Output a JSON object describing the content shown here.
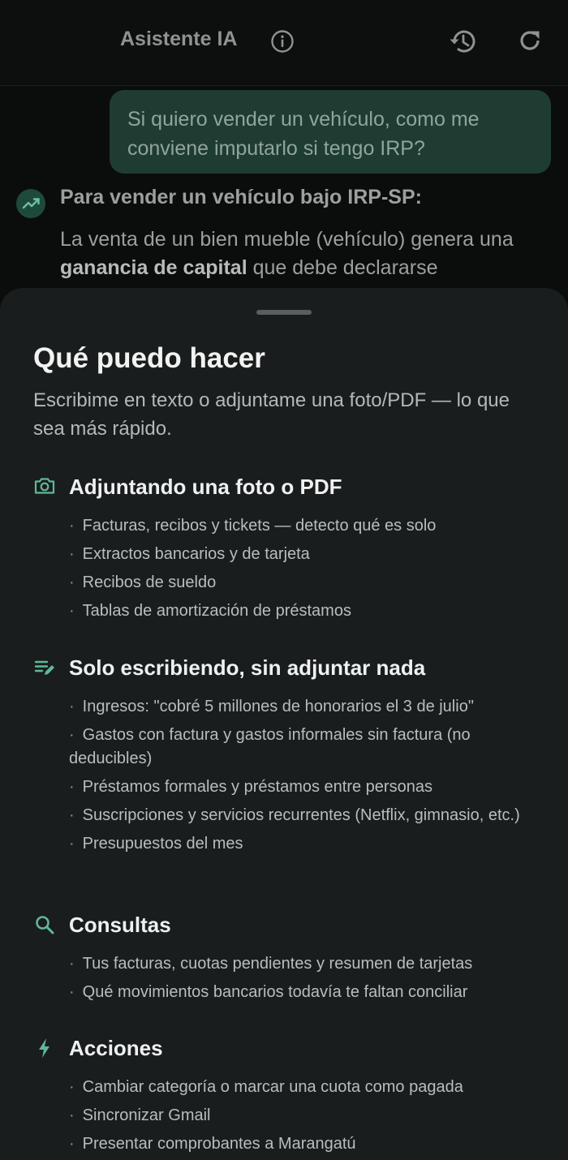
{
  "header": {
    "title": "Asistente IA",
    "icons": [
      "info-icon",
      "history-icon",
      "refresh-icon"
    ]
  },
  "chat": {
    "user_message": "Si quiero vender un vehículo, como me conviene imputarlo si tengo IRP?",
    "ai_heading": "Para vender un vehículo bajo IRP-SP:",
    "ai_body_before": "La venta de un bien mueble (vehículo) genera una ",
    "ai_body_bold": "ganancia de capital",
    "ai_body_after": " que debe declararse"
  },
  "sheet": {
    "title": "Qué puedo hacer",
    "subtitle": "Escribime en texto o adjuntame una foto/PDF — lo que sea más rápido.",
    "sections": [
      {
        "icon": "camera-icon",
        "title": "Adjuntando una foto o PDF",
        "items": [
          "Facturas, recibos y tickets — detecto qué es solo",
          "Extractos bancarios y de tarjeta",
          "Recibos de sueldo",
          "Tablas de amortización de préstamos"
        ]
      },
      {
        "icon": "edit-notes-icon",
        "title": "Solo escribiendo, sin adjuntar nada",
        "items": [
          "Ingresos: \"cobré 5 millones de honorarios el 3 de julio\"",
          "Gastos con factura y gastos informales sin factura (no deducibles)",
          "Préstamos formales y préstamos entre personas",
          "Suscripciones y servicios recurrentes (Netflix, gimnasio, etc.)",
          "Presupuestos del mes"
        ]
      },
      {
        "icon": "search-icon",
        "title": "Consultas",
        "items": [
          "Tus facturas, cuotas pendientes y resumen de tarjetas",
          "Qué movimientos bancarios todavía te faltan conciliar"
        ]
      },
      {
        "icon": "bolt-icon",
        "title": "Acciones",
        "items": [
          "Cambiar categoría o marcar una cuota como pagada",
          "Sincronizar Gmail",
          "Presentar comprobantes a Marangatú"
        ]
      }
    ]
  },
  "colors": {
    "accent": "#5fb89a",
    "background": "#0b0c0c",
    "sheet": "#1a1d1d",
    "user_bubble": "#1f3c33"
  }
}
